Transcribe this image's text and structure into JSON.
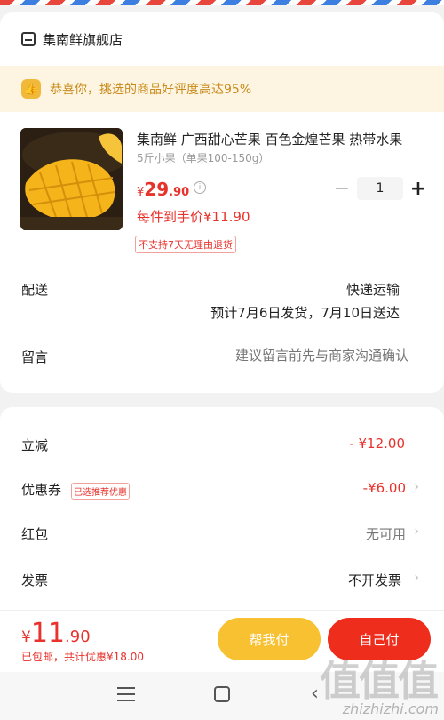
{
  "shop": {
    "name": "集南鲜旗舰店",
    "icon": "store-icon"
  },
  "banner": {
    "text": "恭喜你，挑选的商品好评度高达95%",
    "icon": "thumbs-up-icon"
  },
  "product": {
    "title": "集南鲜 广西甜心芒果 百色金煌芒果 热带水果",
    "spec": "5斤小果（单果100-150g）",
    "price_symbol": "¥",
    "price_int": "29",
    "price_dec": ".90",
    "quantity": "1",
    "unit_price": "每件到手价¥11.90",
    "return_tag": "不支持7天无理由退货"
  },
  "delivery": {
    "label": "配送",
    "method": "快递运输",
    "eta": "预计7月6日发货，7月10日送达"
  },
  "message": {
    "label": "留言",
    "placeholder": "建议留言前先与商家沟通确认"
  },
  "payment": {
    "discount_label": "立减",
    "discount_value": "- ¥12.00",
    "coupon_label": "优惠券",
    "coupon_tag": "已选推荐优惠",
    "coupon_value": "-¥6.00",
    "redpacket_label": "红包",
    "redpacket_value": "无可用",
    "invoice_label": "发票",
    "invoice_value": "不开发票"
  },
  "checkout": {
    "total_symbol": "¥",
    "total_int": "11",
    "total_dec": ".90",
    "total_sub": "已包邮，共计优惠¥18.00",
    "help_pay_label": "帮我付",
    "self_pay_label": "自己付"
  },
  "watermark": {
    "glyphs": "值值值",
    "url": "zhizhizhi.com"
  },
  "colors": {
    "accent": "#e8322c",
    "help_button": "#f8c131",
    "pay_button": "#ef2d1c",
    "banner_bg": "#fdf5e2"
  }
}
